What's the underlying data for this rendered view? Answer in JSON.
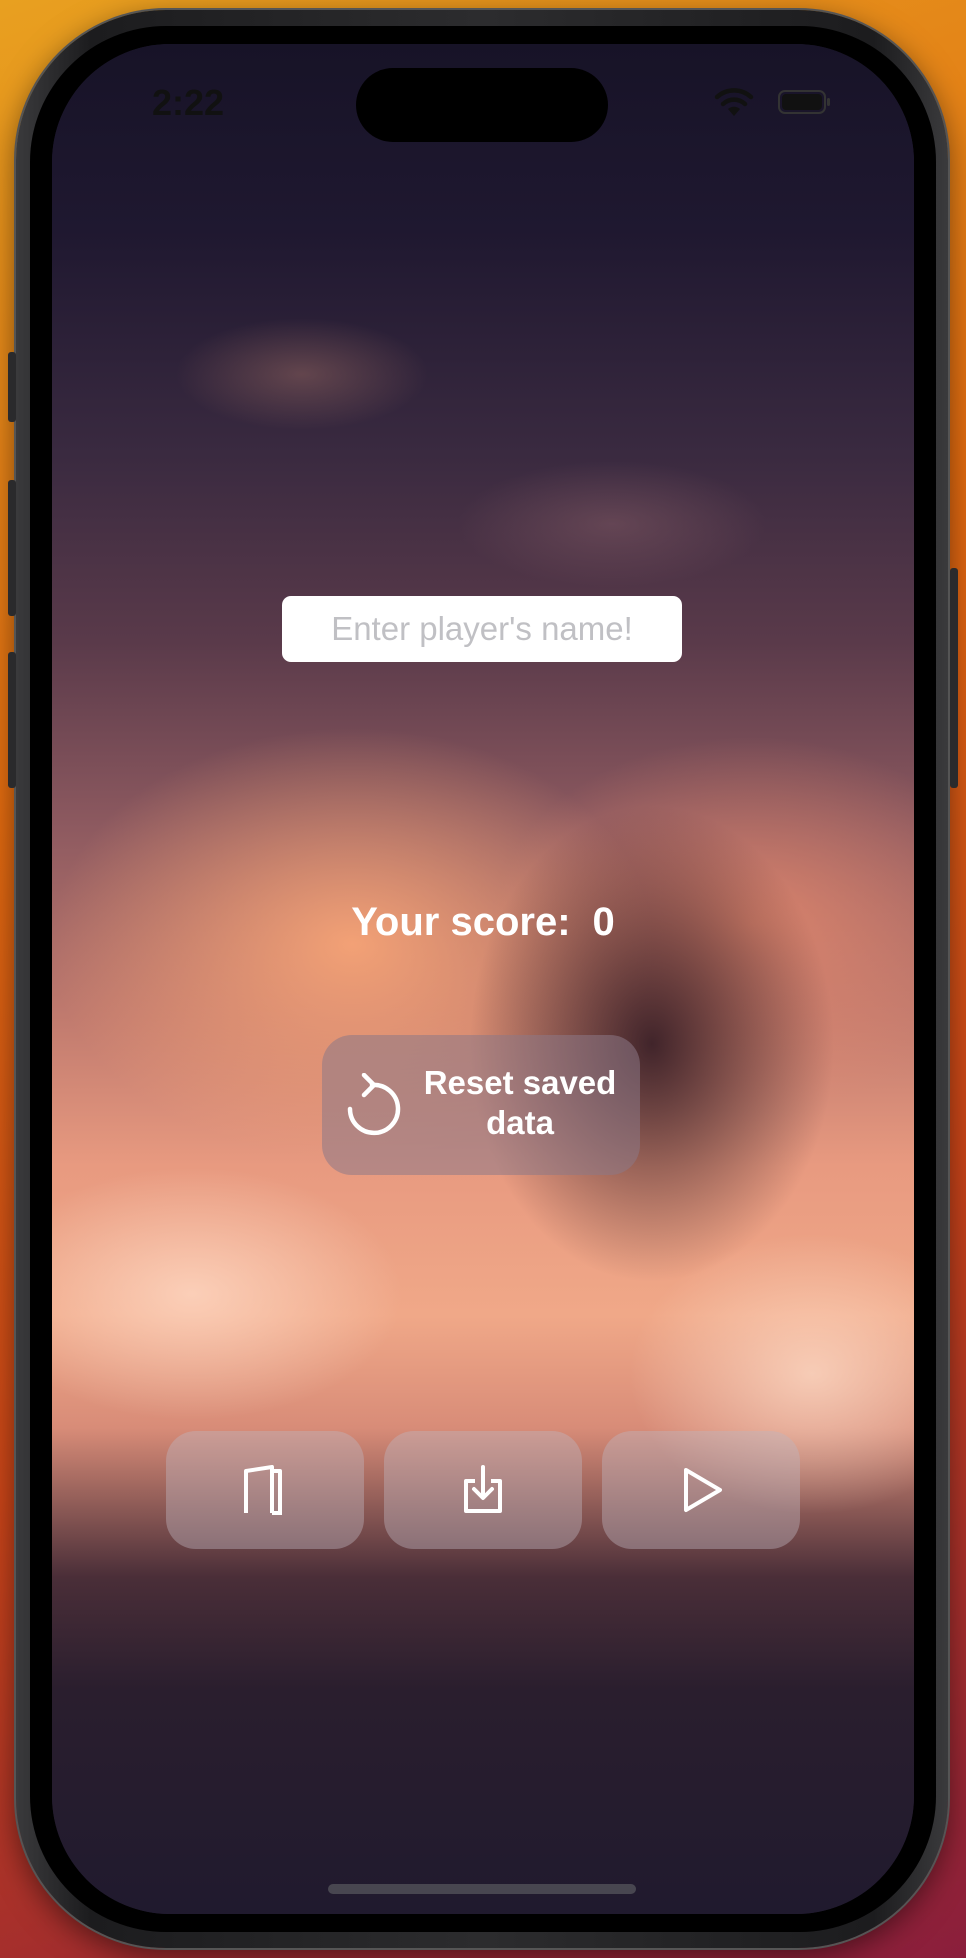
{
  "status_bar": {
    "time": "2:22"
  },
  "player_name_input": {
    "value": "",
    "placeholder": "Enter player's name!"
  },
  "score": {
    "label": "Your score:",
    "value": "0"
  },
  "reset_button": {
    "label": "Reset saved data",
    "icon": "counterclockwise-arrow-icon"
  },
  "actions": [
    {
      "name": "exit",
      "icon": "door-icon"
    },
    {
      "name": "save",
      "icon": "download-tray-icon"
    },
    {
      "name": "play",
      "icon": "play-icon"
    }
  ],
  "colors": {
    "button_glass": "#b4b4be",
    "text": "#ffffff",
    "input_bg": "#ffffff"
  }
}
